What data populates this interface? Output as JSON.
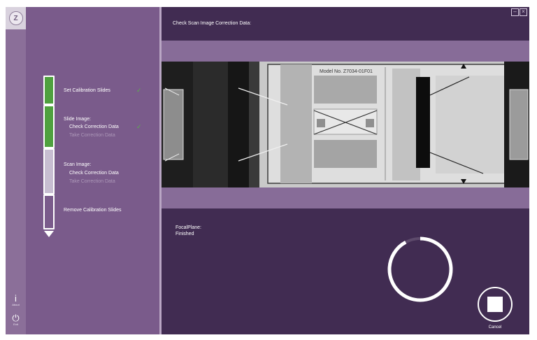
{
  "app": {
    "logo_letter": "Z"
  },
  "rail": {
    "about_label": "About",
    "exit_label": "Exit"
  },
  "steps": {
    "set_calibration": "Set Calibration Slides",
    "slide_image": "Slide Image:",
    "slide_check": "Check Correction Data",
    "slide_take": "Take Correction Data",
    "scan_image": "Scan Image:",
    "scan_check": "Check Correction Data",
    "scan_take": "Take Correction Data",
    "remove_calibration": "Remove Calibration Slides"
  },
  "main": {
    "title": "Check Scan Image Correction Data:",
    "model_text": "Model No. Z7034-01F01",
    "focal_title": "FocalPlane:",
    "focal_status": "Finished",
    "cancel_label": "Cancel",
    "progress_fraction": 0.92
  },
  "colors": {
    "accent_green": "#4fa03f",
    "panel_purple": "#7a5b8b",
    "main_purple": "#412c52"
  }
}
